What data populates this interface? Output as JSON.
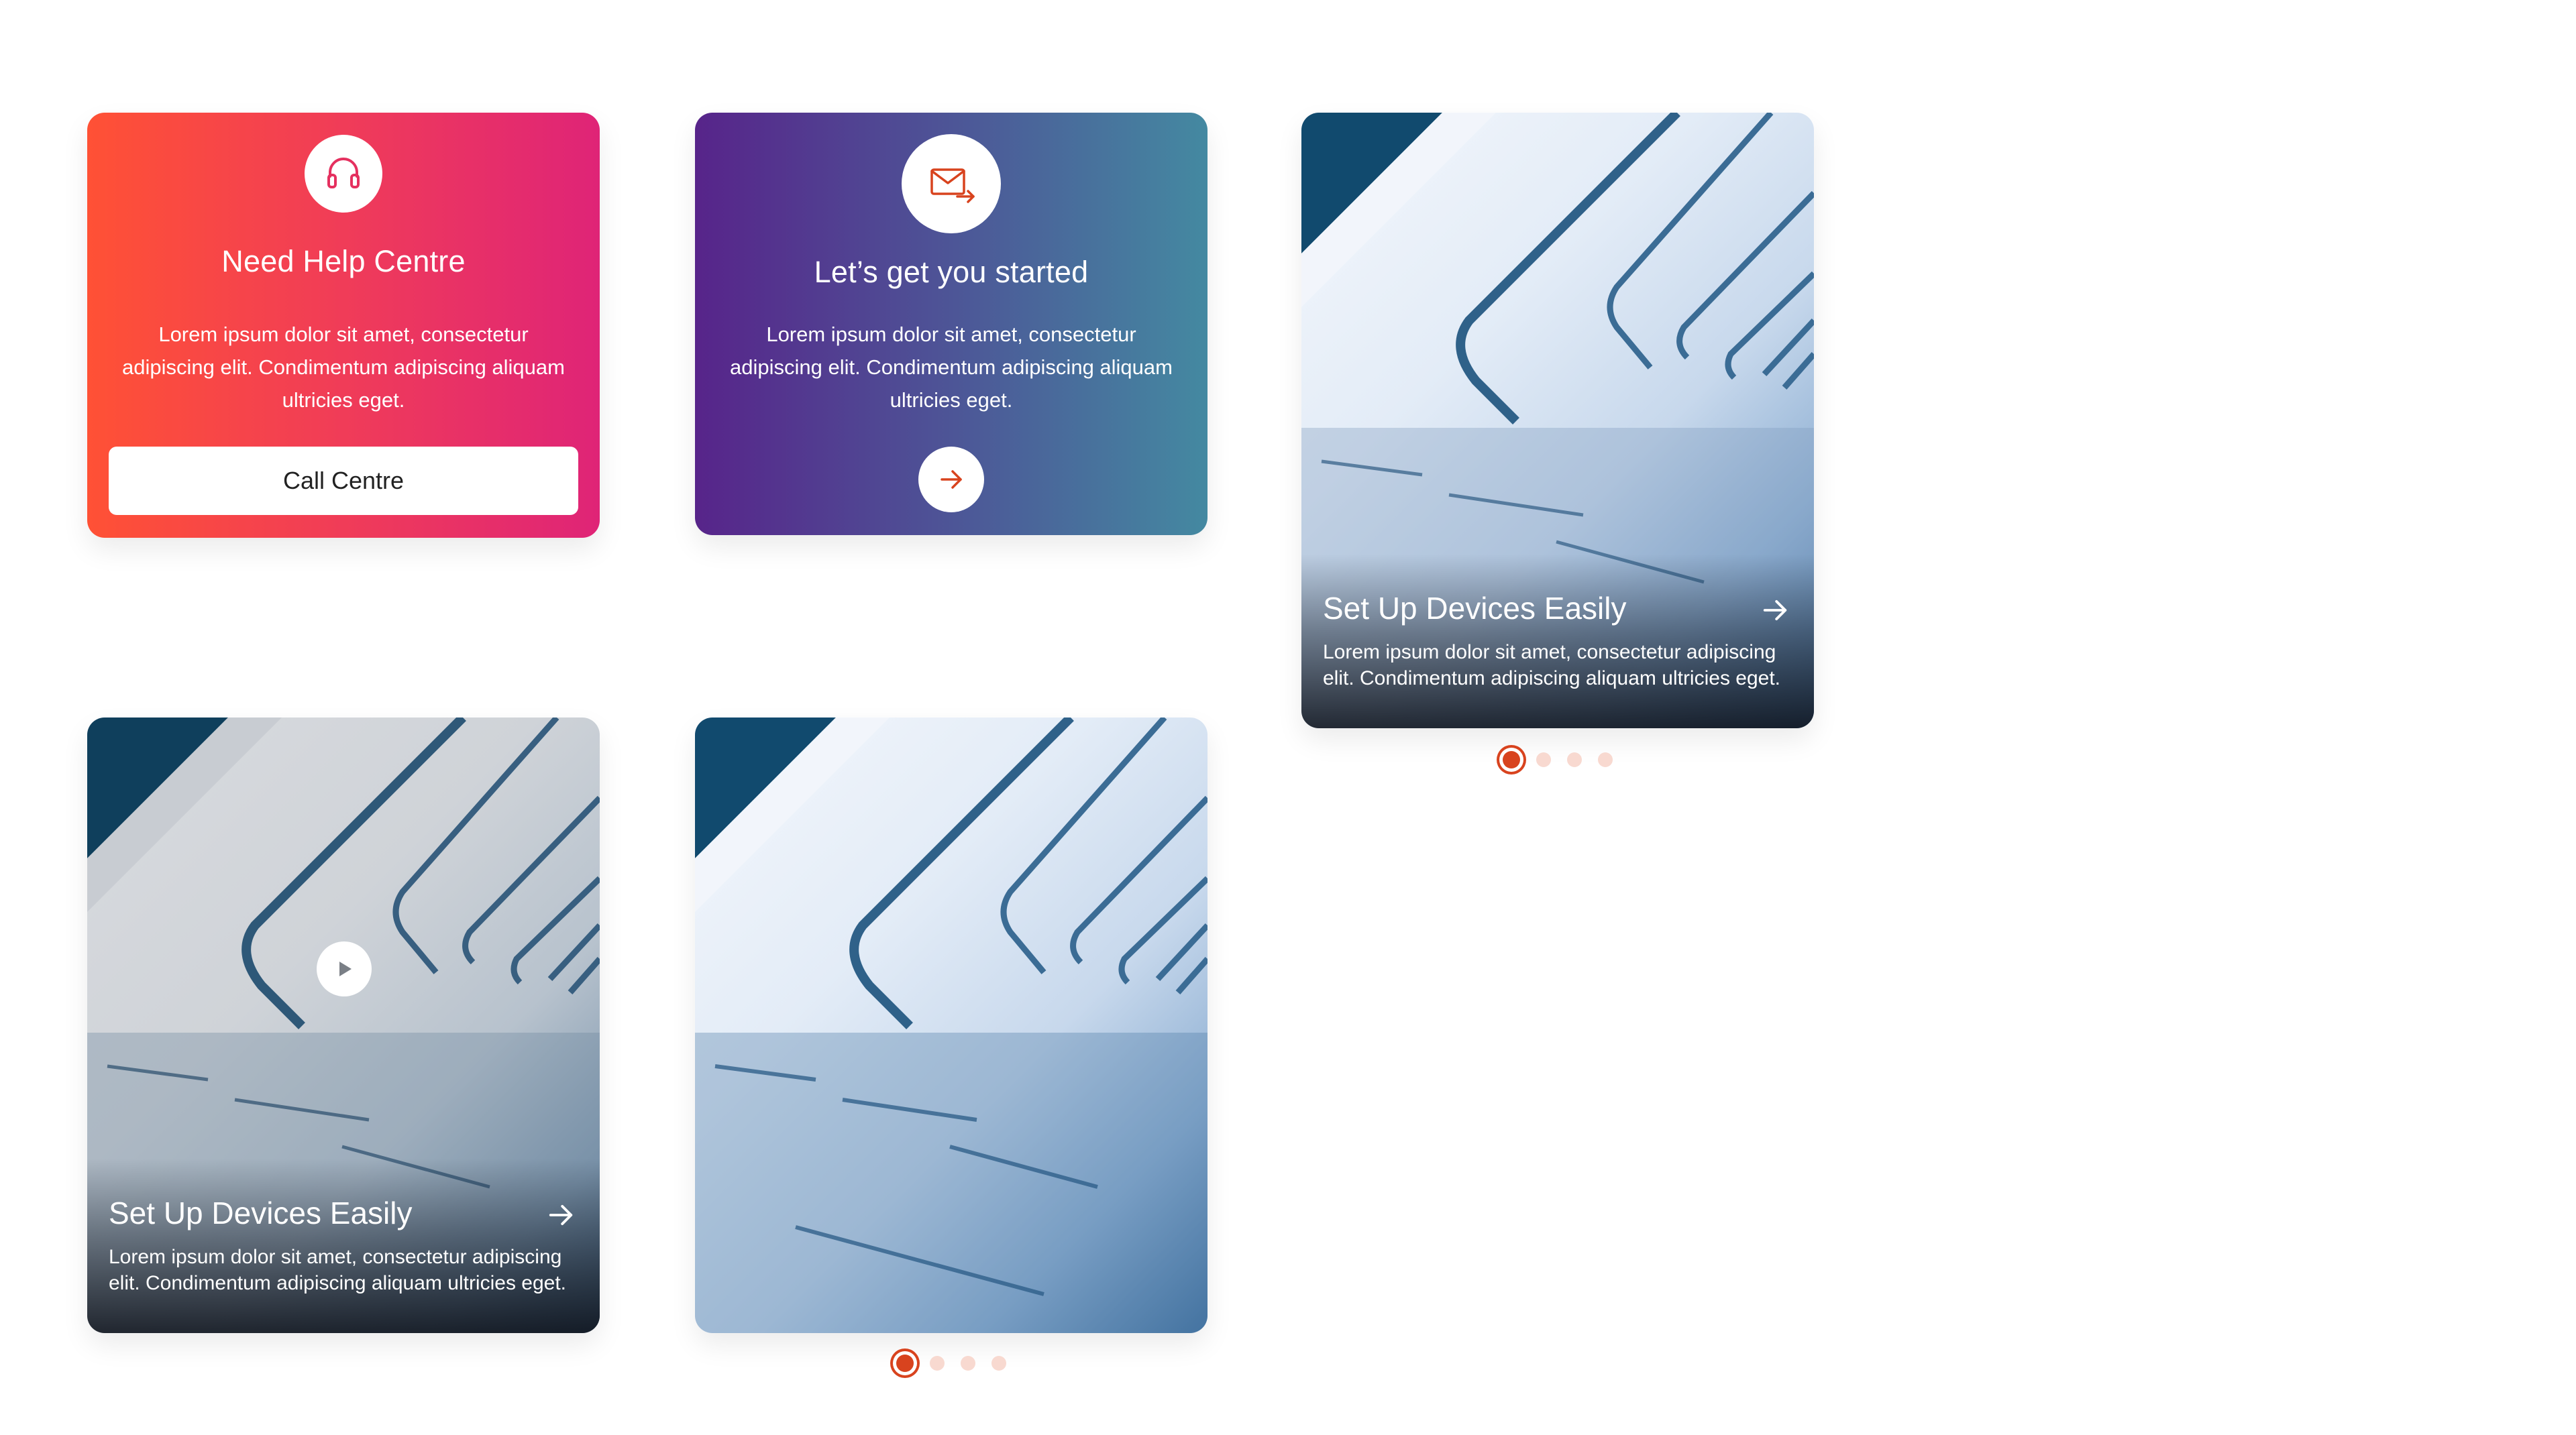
{
  "colors": {
    "accent": "#d8431e",
    "dot_inactive": "#f8d9d0",
    "help_gradient": [
      "#ff5135",
      "#df2477"
    ],
    "start_gradient": [
      "#57248a",
      "#4489a1"
    ]
  },
  "help_card": {
    "icon": "headset-icon",
    "title": "Need Help Centre",
    "body": "Lorem ipsum dolor sit amet, consectetur adipiscing elit. Condimentum adipiscing aliquam ultricies eget.",
    "button_label": "Call Centre"
  },
  "start_card": {
    "icon": "mail-send-icon",
    "title": "Let’s get you started",
    "body": "Lorem ipsum dolor sit amet, consectetur adipiscing elit. Condimentum adipiscing aliquam ultricies eget.",
    "arrow_icon": "arrow-right-icon"
  },
  "setup_card_a": {
    "title": "Set Up Devices Easily",
    "body": "Lorem ipsum dolor sit amet, consectetur adipiscing elit. Condimentum adipiscing aliquam ultricies eget.",
    "arrow_icon": "arrow-right-icon"
  },
  "setup_card_b": {
    "title": "Set Up Devices Easily",
    "body": "Lorem ipsum dolor sit amet, consectetur adipiscing elit. Condimentum adipiscing aliquam ultricies eget.",
    "arrow_icon": "arrow-right-icon",
    "media_icon": "play-icon"
  },
  "carousel_a": {
    "active_index": 0,
    "count": 4
  },
  "carousel_c": {
    "active_index": 0,
    "count": 4
  }
}
